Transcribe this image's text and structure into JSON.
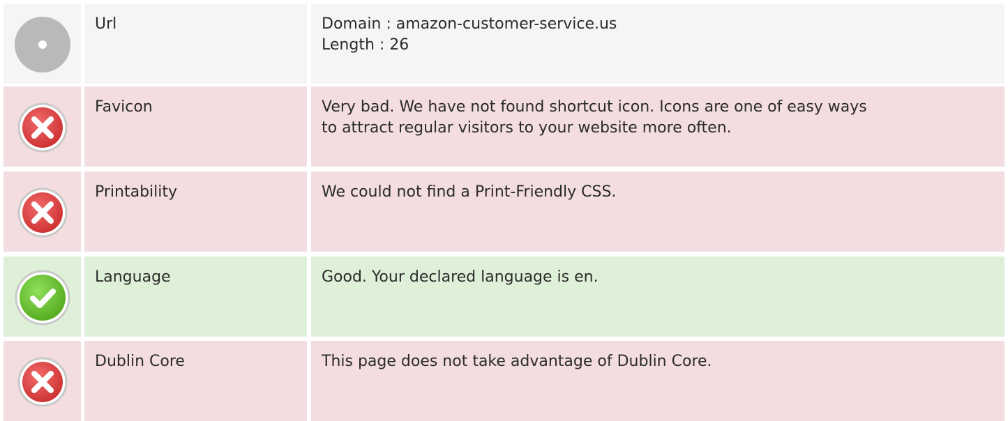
{
  "rows": [
    {
      "status": "neutral",
      "icon": "neutral-circle-icon",
      "label": "Url",
      "desc_lines": [
        "Domain : amazon-customer-service.us",
        "Length : 26"
      ]
    },
    {
      "status": "bad",
      "icon": "error-x-icon",
      "label": "Favicon",
      "desc_lines": [
        "Very bad. We have not found shortcut icon. Icons are one of easy ways",
        "to attract regular visitors to your website more often."
      ]
    },
    {
      "status": "bad",
      "icon": "error-x-icon",
      "label": "Printability",
      "desc_lines": [
        "We could not find a Print-Friendly CSS."
      ]
    },
    {
      "status": "good",
      "icon": "check-mark-icon",
      "label": "Language",
      "desc_lines": [
        "Good. Your declared language is en."
      ]
    },
    {
      "status": "bad",
      "icon": "error-x-icon",
      "label": "Dublin Core",
      "desc_lines": [
        "This page does not take advantage of Dublin Core."
      ]
    }
  ],
  "colors": {
    "neutral_bg": "#f5f5f5",
    "bad_bg": "#f3dde0",
    "good_bg": "#dff0d8",
    "error_red": "#e04848",
    "success_green": "#6cc236",
    "neutral_gray": "#b9b9b9"
  }
}
